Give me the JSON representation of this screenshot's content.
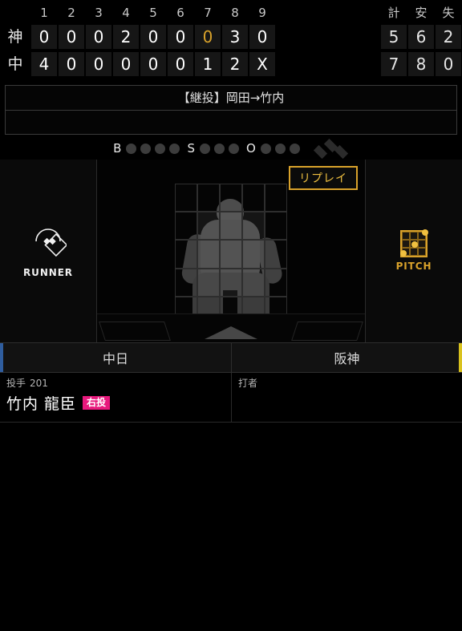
{
  "scoreboard": {
    "inning_headers": [
      "1",
      "2",
      "3",
      "4",
      "5",
      "6",
      "7",
      "8",
      "9"
    ],
    "total_headers": [
      "計",
      "安",
      "失"
    ],
    "current_inning_index": 6,
    "rows": [
      {
        "team": "神",
        "innings": [
          "0",
          "0",
          "0",
          "2",
          "0",
          "0",
          "0",
          "3",
          "0"
        ],
        "totals": [
          "5",
          "6",
          "2"
        ]
      },
      {
        "team": "中",
        "innings": [
          "4",
          "0",
          "0",
          "0",
          "0",
          "0",
          "1",
          "2",
          "X"
        ],
        "totals": [
          "7",
          "8",
          "0"
        ]
      }
    ]
  },
  "message_panel": {
    "line1": "【継投】岡田→竹内",
    "line2": ""
  },
  "count": {
    "ball_label": "B",
    "strike_label": "S",
    "out_label": "O",
    "balls": 0,
    "strikes": 0,
    "outs": 0,
    "ball_dots": 4,
    "strike_dots": 3,
    "out_dots": 3,
    "bases": {
      "first": false,
      "second": false,
      "third": false
    }
  },
  "stage": {
    "runner_label": "RUNNER",
    "runner_icon": "runner-diamond-icon",
    "pitch_label": "PITCH",
    "pitch_icon": "pitch-grid-icon",
    "replay_label": "リプレイ"
  },
  "team_tabs": [
    {
      "label": "中日",
      "accent": "#2f5d9e",
      "side": "home"
    },
    {
      "label": "阪神",
      "accent": "#d9c21e",
      "side": "away"
    }
  ],
  "players": {
    "pitcher": {
      "role": "投手",
      "number": "201",
      "name": "竹内 龍臣",
      "hand_badge": "右投"
    },
    "batter": {
      "role": "打者",
      "number": "",
      "name": "",
      "hand_badge": ""
    }
  },
  "colors": {
    "accent_gold": "#d9a22b",
    "badge_pink": "#e8197d",
    "home_blue": "#2f5d9e",
    "away_yellow": "#d9c21e",
    "background": "#000000"
  }
}
